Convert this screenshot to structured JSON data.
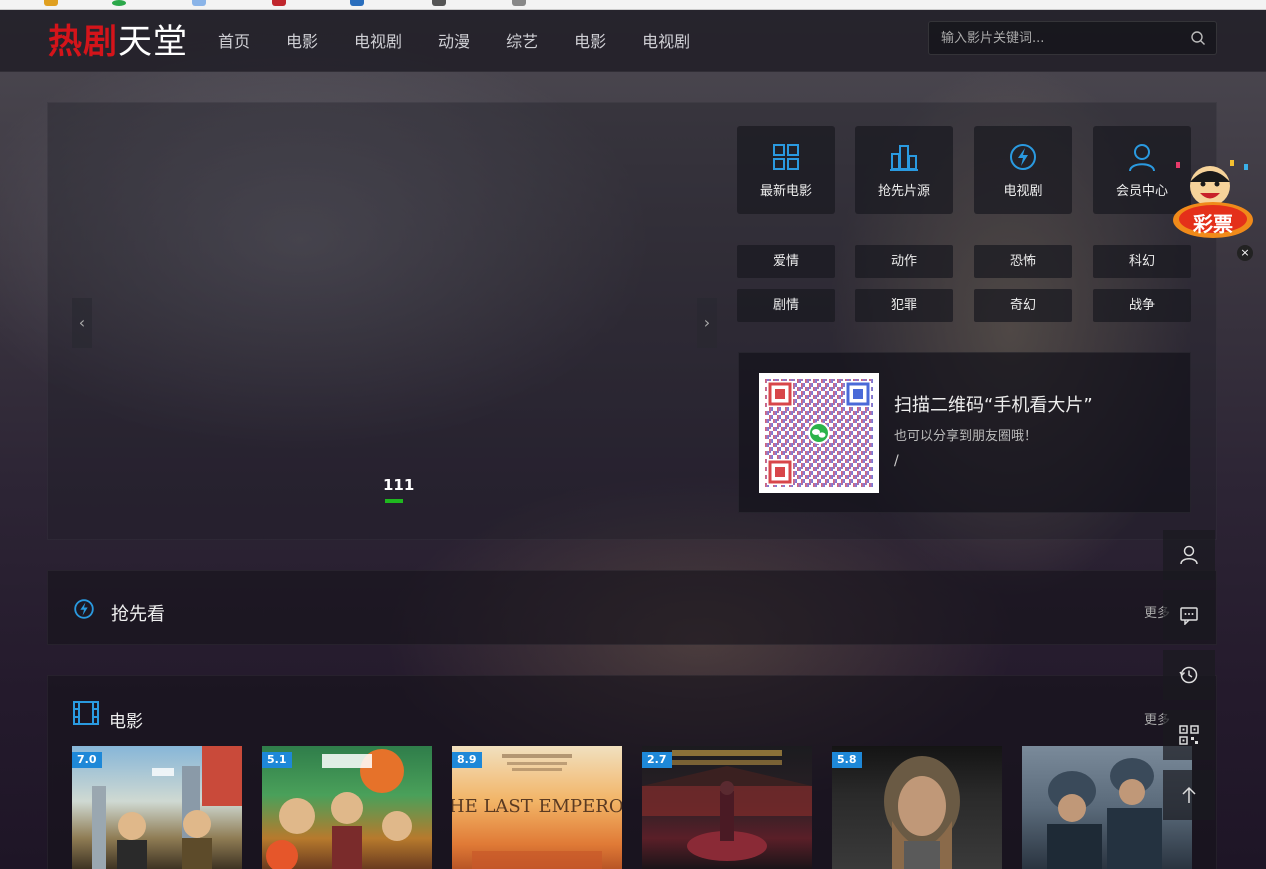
{
  "logo": {
    "part1": "热剧",
    "part2": "天堂"
  },
  "nav": [
    "首页",
    "电影",
    "电视剧",
    "动漫",
    "综艺",
    "电影",
    "电视剧"
  ],
  "search": {
    "placeholder": "输入影片关键词..."
  },
  "slider": {
    "title": "111",
    "prev": "‹",
    "next": "›"
  },
  "quick_links": [
    {
      "label": "最新电影",
      "icon": "grid-icon"
    },
    {
      "label": "抢先片源",
      "icon": "bar-chart-icon"
    },
    {
      "label": "电视剧",
      "icon": "lightning-icon"
    },
    {
      "label": "会员中心",
      "icon": "user-icon"
    }
  ],
  "genres": [
    "爱情",
    "动作",
    "恐怖",
    "科幻",
    "剧情",
    "犯罪",
    "奇幻",
    "战争"
  ],
  "qr": {
    "title": "扫描二维码“手机看大片”",
    "subtitle": "也可以分享到朋友圈哦！",
    "slash": "/"
  },
  "sections": {
    "preview": {
      "title": "抢先看",
      "more": "更多"
    },
    "movies": {
      "title": "电影",
      "more": "更多"
    }
  },
  "posters": [
    {
      "score": "7.0"
    },
    {
      "score": "5.1"
    },
    {
      "score": "8.9",
      "text": "THE LAST EMPEROR"
    },
    {
      "score": "2.7"
    },
    {
      "score": "5.8"
    },
    {
      "score": ""
    }
  ],
  "lottery": {
    "label": "彩票"
  },
  "close": "×",
  "colors": {
    "accent_blue": "#1e88d8",
    "logo_red": "#d4141a",
    "slider_green": "#1fb81f"
  }
}
